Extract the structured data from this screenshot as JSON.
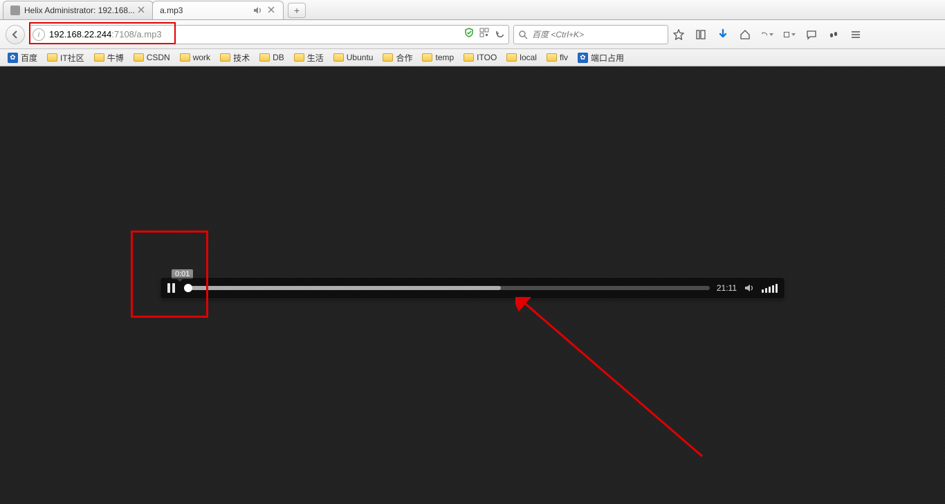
{
  "tabs": [
    {
      "title": "Helix Administrator: 192.168...",
      "active": false
    },
    {
      "title": "a.mp3",
      "active": true,
      "sound": true
    }
  ],
  "url": {
    "host": "192.168.22.244",
    "port": ":7108",
    "path": "/a.mp3"
  },
  "search": {
    "placeholder": "百度 <Ctrl+K>"
  },
  "bookmarks": [
    {
      "icon": "paw",
      "label": "百度"
    },
    {
      "icon": "folder",
      "label": "IT社区"
    },
    {
      "icon": "folder",
      "label": "牛博"
    },
    {
      "icon": "folder",
      "label": "CSDN"
    },
    {
      "icon": "folder",
      "label": "work"
    },
    {
      "icon": "folder",
      "label": "技术"
    },
    {
      "icon": "folder",
      "label": "DB"
    },
    {
      "icon": "folder",
      "label": "生活"
    },
    {
      "icon": "folder",
      "label": "Ubuntu"
    },
    {
      "icon": "folder",
      "label": "合作"
    },
    {
      "icon": "folder",
      "label": "temp"
    },
    {
      "icon": "folder",
      "label": "ITOO"
    },
    {
      "icon": "folder",
      "label": "local"
    },
    {
      "icon": "folder",
      "label": "flv"
    },
    {
      "icon": "paw",
      "label": "端口占用"
    }
  ],
  "player": {
    "tooltip": "0:01",
    "duration": "21:11"
  }
}
